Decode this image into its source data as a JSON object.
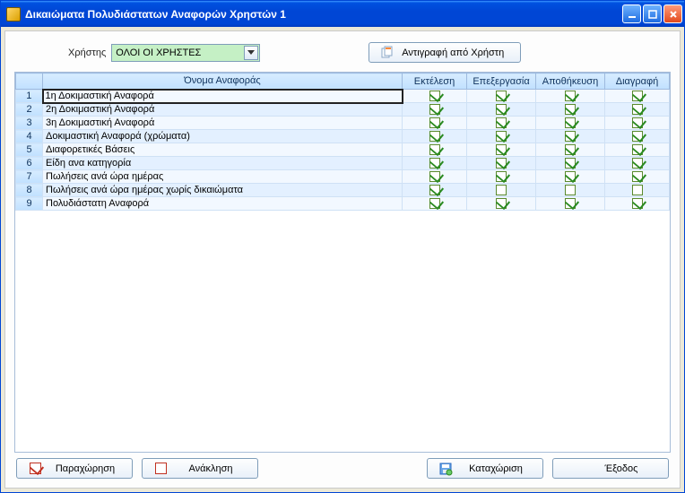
{
  "window": {
    "title": "Δικαιώματα Πολυδιάστατων Αναφορών Χρηστών 1"
  },
  "toolbar": {
    "user_label": "Χρήστης",
    "user_value": "ΟΛΟΙ ΟΙ ΧΡΗΣΤΕΣ",
    "copy_label": "Αντιγραφή από Χρήστη"
  },
  "grid": {
    "headers": {
      "name": "Όνομα Αναφοράς",
      "exec": "Εκτέλεση",
      "edit": "Επεξεργασία",
      "save": "Αποθήκευση",
      "del": "Διαγραφή"
    },
    "rows": [
      {
        "num": "1",
        "name": "1η Δοκιμαστική Αναφορά",
        "exec": true,
        "edit": true,
        "save": true,
        "del": true
      },
      {
        "num": "2",
        "name": "2η Δοκιμαστική  Αναφορά",
        "exec": true,
        "edit": true,
        "save": true,
        "del": true
      },
      {
        "num": "3",
        "name": "3η Δοκιμαστική Αναφορά",
        "exec": true,
        "edit": true,
        "save": true,
        "del": true
      },
      {
        "num": "4",
        "name": "Δοκιμαστική Αναφορά (χρώματα)",
        "exec": true,
        "edit": true,
        "save": true,
        "del": true
      },
      {
        "num": "5",
        "name": "Διαφορετικές Βάσεις",
        "exec": true,
        "edit": true,
        "save": true,
        "del": true
      },
      {
        "num": "6",
        "name": "Είδη ανα κατηγορία",
        "exec": true,
        "edit": true,
        "save": true,
        "del": true
      },
      {
        "num": "7",
        "name": "Πωλήσεις ανά ώρα ημέρας",
        "exec": true,
        "edit": true,
        "save": true,
        "del": true
      },
      {
        "num": "8",
        "name": "Πωλήσεις ανά ώρα ημέρας χωρίς δικαιώματα",
        "exec": true,
        "edit": false,
        "save": false,
        "del": false
      },
      {
        "num": "9",
        "name": "Πολυδιάστατη Αναφορά",
        "exec": true,
        "edit": true,
        "save": true,
        "del": true
      }
    ]
  },
  "footer": {
    "grant": "Παραχώρηση",
    "revoke": "Ανάκληση",
    "save": "Καταχώριση",
    "exit": "Έξοδος"
  }
}
